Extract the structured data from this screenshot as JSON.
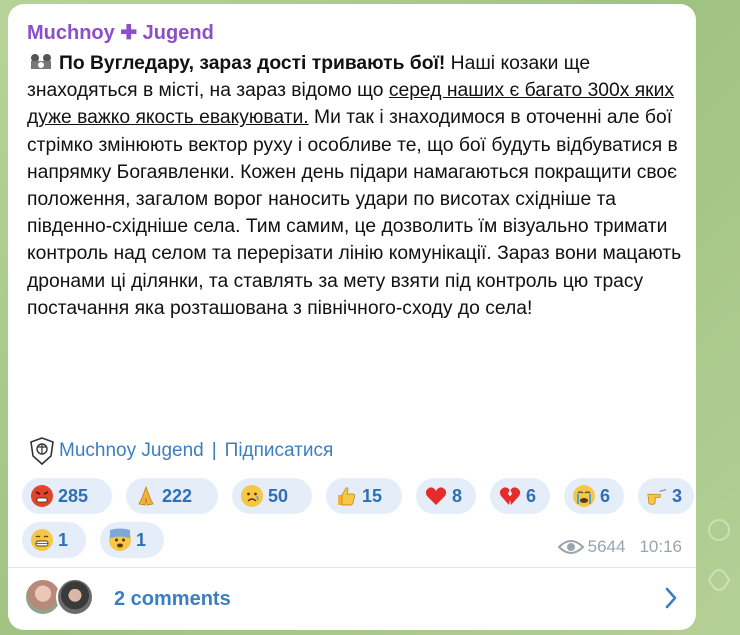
{
  "channel": {
    "name_part1": "Muchnoy",
    "name_plus": "✚",
    "name_part2": "Jugend"
  },
  "message": {
    "headline": "По Вугледару, зараз дості тривають бої!",
    "text_part1": " Наші козаки ще знаходяться в місті, на зараз відомо що ",
    "underlined": "серед наших є багато 300х яких дуже важко якость евакуювати.",
    "text_part2": " Ми так і знаходимося в оточенні але бої стрімко змінюють вектор руху і особливе те, що бої будуть відбуватися в напрямку Богаявленки. Кожен день підари намагаються покращити своє положення, загалом ворог наносить удари по висотах східніше та південно-східніше села. Тим самим, це дозволить їм візуально тримати контроль над селом та перерізати лінію комунікації. Зараз вони мацають дронами ці ділянки, та ставлять за мету взяти під контроль цю трасу постачання яка розташована з північного-сходу до села!"
  },
  "footer": {
    "channel_link": "Muchnoy Jugend",
    "separator": "|",
    "subscribe": "Підписатися"
  },
  "reactions": [
    {
      "icon": "angry-face-icon",
      "count": "285"
    },
    {
      "icon": "praying-hands-icon",
      "count": "222"
    },
    {
      "icon": "sad-face-icon",
      "count": "50"
    },
    {
      "icon": "thumbs-up-icon",
      "count": "15"
    },
    {
      "icon": "red-heart-icon",
      "count": "8"
    },
    {
      "icon": "broken-heart-icon",
      "count": "6"
    },
    {
      "icon": "crying-face-icon",
      "count": "6"
    },
    {
      "icon": "pointing-hand-icon",
      "count": "3"
    },
    {
      "icon": "grinning-face-icon",
      "count": "1"
    },
    {
      "icon": "fearful-face-icon",
      "count": "1"
    }
  ],
  "meta": {
    "views": "5644",
    "time": "10:16"
  },
  "comments": {
    "label": "2 comments"
  },
  "colors": {
    "sender": "#8c4ec9",
    "link": "#3a7fc1",
    "reaction_bg": "#e5eef8"
  }
}
